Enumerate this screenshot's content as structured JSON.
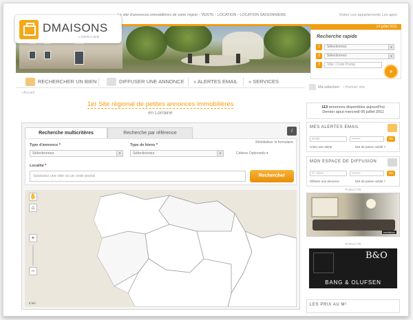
{
  "header": {
    "tagline_parts": [
      "Le site d'annonces immobilières de votre région",
      "VENTE",
      "LOCATION",
      "LOCATION SAISONNIÈRE"
    ],
    "top_links": "Visiter Les appartements Les apps",
    "logo_brand": "DMAISONS",
    "logo_region": "LORRAINE",
    "date": "14 juillet 2011"
  },
  "quick_search": {
    "title": "Recherche rapide",
    "steps": [
      {
        "num": "1",
        "value": "Sélectionnez"
      },
      {
        "num": "2",
        "value": "Sélectionnez"
      },
      {
        "num": "3",
        "placeholder": "Ville / Code Postal"
      }
    ],
    "go_label": "»"
  },
  "nav": {
    "items": [
      {
        "label": "RECHERCHER UN BIEN",
        "prefix": ""
      },
      {
        "label": "DIFFUSER UNE ANNONCE",
        "prefix": ""
      },
      {
        "label": "ALERTES EMAIL",
        "prefix": "» "
      },
      {
        "label": "SERVICES",
        "prefix": "» "
      }
    ],
    "selection": "Ma sélection",
    "selection_extra": "• Partner site"
  },
  "breadcrumb": "› Accueil",
  "headline": {
    "title": "1er Site régional de petites annonces immobilières",
    "subtitle": "en Lorraine"
  },
  "search_panel": {
    "tabs": [
      "Recherche multicritères",
      "Recherche par référence"
    ],
    "info_label": "i",
    "type_annonce_label": "Type d'annonce",
    "type_annonce_value": "Sélectionnez",
    "type_bien_label": "Type de biens",
    "type_bien_value": "Sélectionnez",
    "reset_link": "Réinitialiser le formulaire",
    "criteres_link": "Critères Optionnels ▾",
    "localite_label": "Localité",
    "localite_placeholder": "Saisissez une ville ou un code postal",
    "submit_label": "Rechercher"
  },
  "map": {
    "zoom_in": "+",
    "zoom_out": "–",
    "scale": "5 km"
  },
  "sidebar": {
    "count_number": "113",
    "count_text": " annonces disponibles aujourd'hui",
    "last_update": "Dernier ajout mercredi 06 juillet 2011",
    "alerts": {
      "title": "MES ALERTES EMAIL",
      "email_placeholder": "Email",
      "password_placeholder": "••••••••",
      "ok": "OK",
      "create_link": "Créer une alerte",
      "forgot_link": "Mot de passe oublié ?"
    },
    "diffusion": {
      "title": "MON ESPACE DE DIFFUSION",
      "id_placeholder": "N° client",
      "password_placeholder": "••••••••",
      "ok": "OK",
      "create_link": "Diffuser une annonce",
      "forgot_link": "Mot de passe oublié ?"
    },
    "ad_label_1": "PUBLICITÉ",
    "ad_label_2": "PUBLICITÉ",
    "room_ad_tag": "mediabox",
    "bo_logo": "B&O",
    "bo_text": "BANG & OLUFSEN",
    "prix_title": "LES PRIX AU M²"
  },
  "colors": {
    "accent": "#f29e10",
    "text": "#555555",
    "map_bg": "#ece7dc"
  }
}
